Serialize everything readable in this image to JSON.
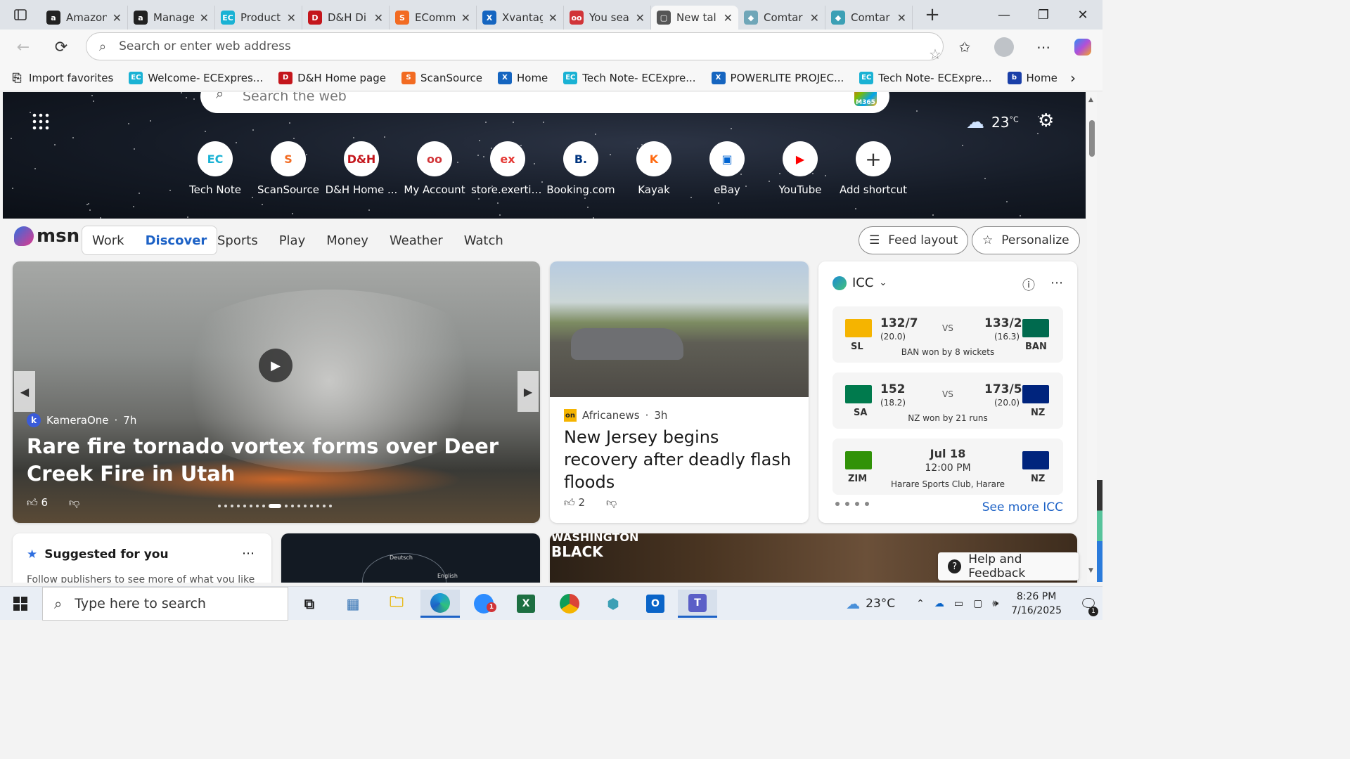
{
  "browser": {
    "tabs": [
      {
        "label": "Amazon",
        "fav_text": "a",
        "fav_color": "#222222"
      },
      {
        "label": "Manage",
        "fav_text": "a",
        "fav_color": "#222222"
      },
      {
        "label": "Product",
        "fav_text": "EC",
        "fav_color": "#1ab2d4"
      },
      {
        "label": "D&H Di",
        "fav_text": "D",
        "fav_color": "#c4161c"
      },
      {
        "label": "EComm",
        "fav_text": "S",
        "fav_color": "#f26b22"
      },
      {
        "label": "Xvantag",
        "fav_text": "X",
        "fav_color": "#1565c0"
      },
      {
        "label": "You sea",
        "fav_text": "oo",
        "fav_color": "#d13438"
      },
      {
        "label": "New tal",
        "fav_text": "▢",
        "fav_color": "#555555"
      },
      {
        "label": "Comtar",
        "fav_text": "◆",
        "fav_color": "#6fa6b8"
      },
      {
        "label": "Comtar",
        "fav_text": "◆",
        "fav_color": "#3ca0b5"
      }
    ],
    "active_tab_index": 7,
    "address_placeholder": "Search or enter web address",
    "favorites": [
      {
        "label": "Import favorites",
        "icon": "import-icon",
        "color": "#333333",
        "fi": "⎘"
      },
      {
        "label": "Welcome- ECExpres...",
        "icon": "ec-icon",
        "color": "#1ab2d4",
        "fi": "EC"
      },
      {
        "label": "D&H Home page",
        "icon": "dh-icon",
        "color": "#c4161c",
        "fi": "D"
      },
      {
        "label": "ScanSource",
        "icon": "scansource-icon",
        "color": "#f26b22",
        "fi": "S"
      },
      {
        "label": "Home",
        "icon": "xvantage-icon",
        "color": "#1565c0",
        "fi": "X"
      },
      {
        "label": "Tech Note- ECExpre...",
        "icon": "ec-icon",
        "color": "#1ab2d4",
        "fi": "EC"
      },
      {
        "label": "POWERLITE PROJEC...",
        "icon": "xvantage-icon",
        "color": "#1565c0",
        "fi": "X"
      },
      {
        "label": "Tech Note- ECExpre...",
        "icon": "ec-icon",
        "color": "#1ab2d4",
        "fi": "EC"
      },
      {
        "label": "Home",
        "icon": "brother-icon",
        "color": "#1a3fa8",
        "fi": "b"
      }
    ]
  },
  "hero": {
    "search_placeholder": "Search the web",
    "m365_label": "M365",
    "weather_temp": "23",
    "weather_unit": "°C",
    "shortcuts": [
      {
        "label": "Tech Note",
        "ic": "EC",
        "color": "#1ab2d4"
      },
      {
        "label": "ScanSource",
        "ic": "S",
        "color": "#f26b22"
      },
      {
        "label": "D&H Home ...",
        "ic": "D&H",
        "color": "#c4161c"
      },
      {
        "label": "My Account",
        "ic": "oo",
        "color": "#d13438"
      },
      {
        "label": "store.exertis...",
        "ic": "ex",
        "color": "#e53935"
      },
      {
        "label": "Booking.com",
        "ic": "B.",
        "color": "#003580"
      },
      {
        "label": "Kayak",
        "ic": "K",
        "color": "#ff690f"
      },
      {
        "label": "eBay",
        "ic": "▣",
        "color": "#0064d2"
      },
      {
        "label": "YouTube",
        "ic": "▶",
        "color": "#ff0000"
      },
      {
        "label": "Add shortcut",
        "ic": "+",
        "color": "#333333"
      }
    ]
  },
  "msn": {
    "logo_text": "msn",
    "pill_tabs": [
      "Work",
      "Discover"
    ],
    "active_pill": "Discover",
    "nav": [
      "Sports",
      "Play",
      "Money",
      "Weather",
      "Watch"
    ],
    "feed_layout": "Feed layout",
    "personalize": "Personalize"
  },
  "main_story": {
    "source": "KameraOne",
    "time": "7h",
    "headline": "Rare fire tornado vortex forms over Deer Creek Fire in Utah",
    "likes": "6"
  },
  "news_story": {
    "source": "Africanews",
    "time": "3h",
    "headline": "New Jersey begins recovery after deadly flash floods",
    "likes": "2"
  },
  "icc": {
    "title": "ICC",
    "vs": "VS",
    "see_more": "See more ICC",
    "matches": [
      {
        "t1": "SL",
        "s1": "132/7",
        "o1": "(20.0)",
        "t2": "BAN",
        "s2": "133/2",
        "o2": "(16.3)",
        "result": "BAN won by 8 wickets",
        "f1": "#f5b400",
        "f2": "#006a4e"
      },
      {
        "t1": "SA",
        "s1": "152",
        "o1": "(18.2)",
        "t2": "NZ",
        "s2": "173/5",
        "o2": "(20.0)",
        "result": "NZ won by 21 runs",
        "f1": "#007a4d",
        "f2": "#00247d"
      },
      {
        "t1": "ZIM",
        "t2": "NZ",
        "date": "Jul 18",
        "time": "12:00 PM",
        "venue": "Harare Sports Club, Harare",
        "f1": "#319208",
        "f2": "#00247d"
      }
    ]
  },
  "bottom": {
    "suggested_title": "Suggested for you",
    "suggested_sub": "Follow publishers to see more of what you like",
    "wb_title_1": "WASHINGTON",
    "wb_title_2": "BLACK",
    "help": "Help and Feedback",
    "globe_l1": "Deutsch",
    "globe_l2": "English"
  },
  "taskbar": {
    "search_placeholder": "Type here to search",
    "weather": "23°C",
    "time": "8:26 PM",
    "date": "7/16/2025",
    "notif_count": "1",
    "zoom_badge": "1"
  }
}
